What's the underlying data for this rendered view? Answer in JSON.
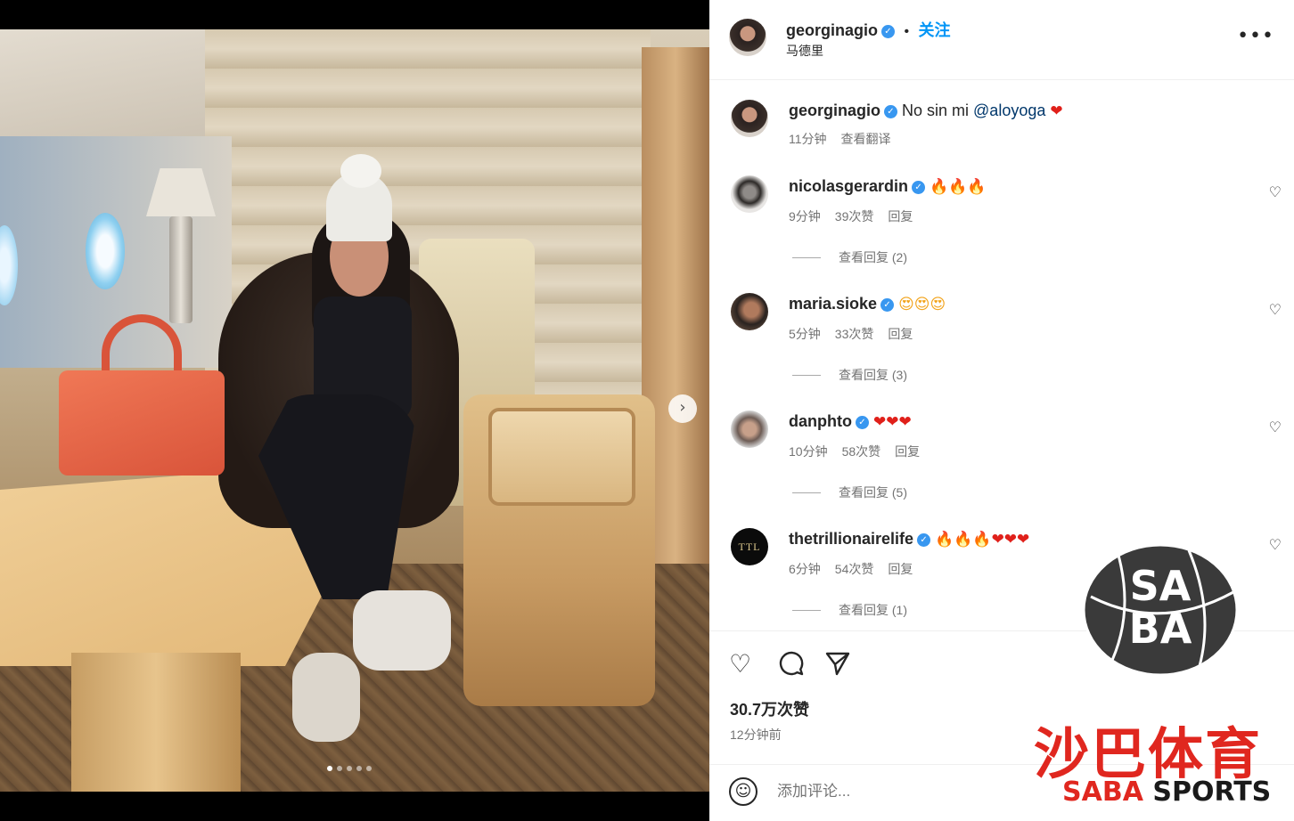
{
  "post": {
    "author": "georginagio",
    "follow_label": "关注",
    "separator": "•",
    "location": "马德里",
    "more_icon": "more-horizontal-icon",
    "verified_glyph": "✓"
  },
  "caption": {
    "username": "georginagio",
    "text": "No sin mi ",
    "mention": "@aloyoga",
    "emoji": "❤",
    "time": "11分钟",
    "translate": "查看翻译"
  },
  "comments": [
    {
      "username": "nicolasgerardin",
      "emoji": "🔥🔥🔥",
      "emoji_kind": "fire",
      "time": "9分钟",
      "likes": "39次赞",
      "reply": "回复",
      "view_replies": "查看回复 (2)"
    },
    {
      "username": "maria.sioke",
      "emoji": "😍😍😍",
      "emoji_kind": "smile",
      "time": "5分钟",
      "likes": "33次赞",
      "reply": "回复",
      "view_replies": "查看回复 (3)"
    },
    {
      "username": "danphto",
      "emoji": "❤❤❤",
      "emoji_kind": "heart",
      "time": "10分钟",
      "likes": "58次赞",
      "reply": "回复",
      "view_replies": "查看回复 (5)"
    },
    {
      "username": "thetrillionairelife",
      "emoji_fire": "🔥🔥🔥",
      "emoji_heart": "❤❤❤",
      "avatar_text": "TTL",
      "time": "6分钟",
      "likes": "54次赞",
      "reply": "回复",
      "view_replies": "查看回复 (1)"
    }
  ],
  "actions": {
    "like_icon": "heart-outline-icon",
    "comment_icon": "comment-bubble-icon",
    "share_icon": "paper-plane-icon",
    "likes": "30.7万次赞",
    "posted": "12分钟前"
  },
  "composer": {
    "placeholder": "添加评论..."
  },
  "carousel": {
    "next_icon": "chevron-right-icon",
    "next_glyph": "›",
    "slides": 5,
    "active_slide": 1
  },
  "watermark": {
    "logo_text": "SABA",
    "cn": "沙巴体育",
    "en_red": "SABA",
    "en_black": " SPORTS"
  },
  "colors": {
    "accent": "#0095f6",
    "verified": "#3897f0",
    "mention": "#00376b",
    "meta": "#737373",
    "watermark_red": "#e0271f"
  }
}
